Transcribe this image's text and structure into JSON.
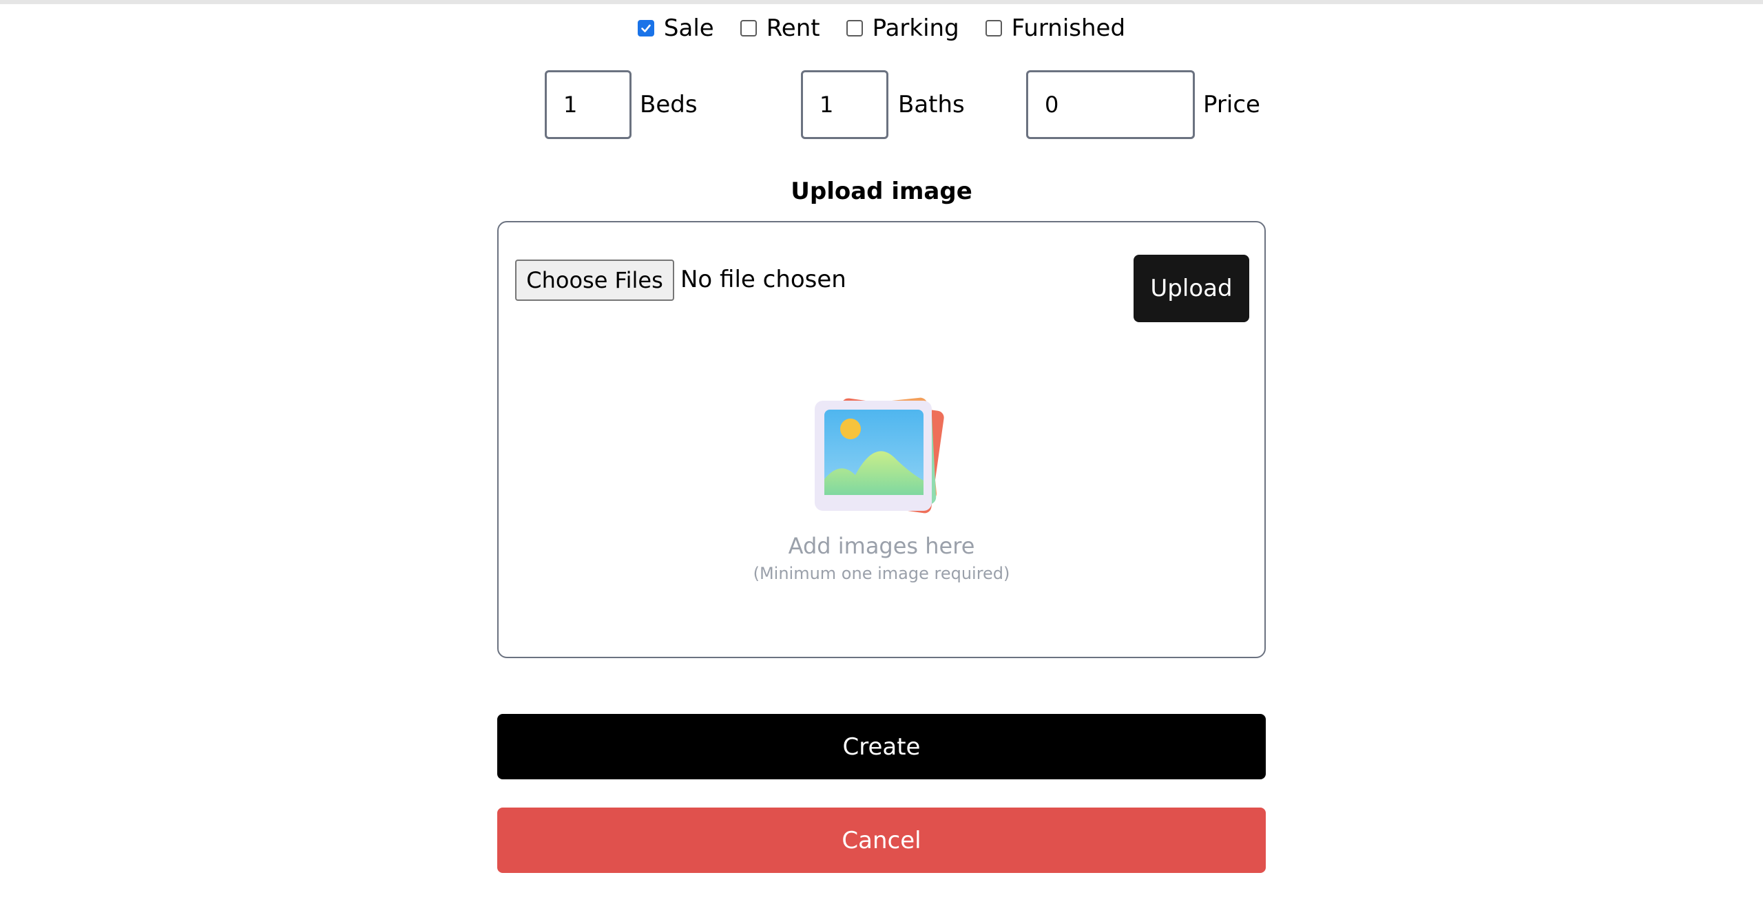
{
  "options": [
    {
      "label": "Sale",
      "checked": true
    },
    {
      "label": "Rent",
      "checked": false
    },
    {
      "label": "Parking",
      "checked": false
    },
    {
      "label": "Furnished",
      "checked": false
    }
  ],
  "fields": {
    "beds": {
      "value": "1",
      "label": "Beds"
    },
    "baths": {
      "value": "1",
      "label": "Baths"
    },
    "price": {
      "value": "0",
      "label": "Price"
    }
  },
  "upload": {
    "title": "Upload image",
    "choose_label": "Choose Files",
    "file_status": "No file chosen",
    "upload_label": "Upload",
    "empty_title": "Add images here",
    "empty_subtitle": "(Minimum one image required)"
  },
  "actions": {
    "create_label": "Create",
    "cancel_label": "Cancel"
  },
  "colors": {
    "checkbox_checked": "#1a73e8",
    "primary_button": "#000000",
    "upload_button": "#161616",
    "cancel_button": "#e0514d",
    "muted_text": "#9aa0aa"
  }
}
